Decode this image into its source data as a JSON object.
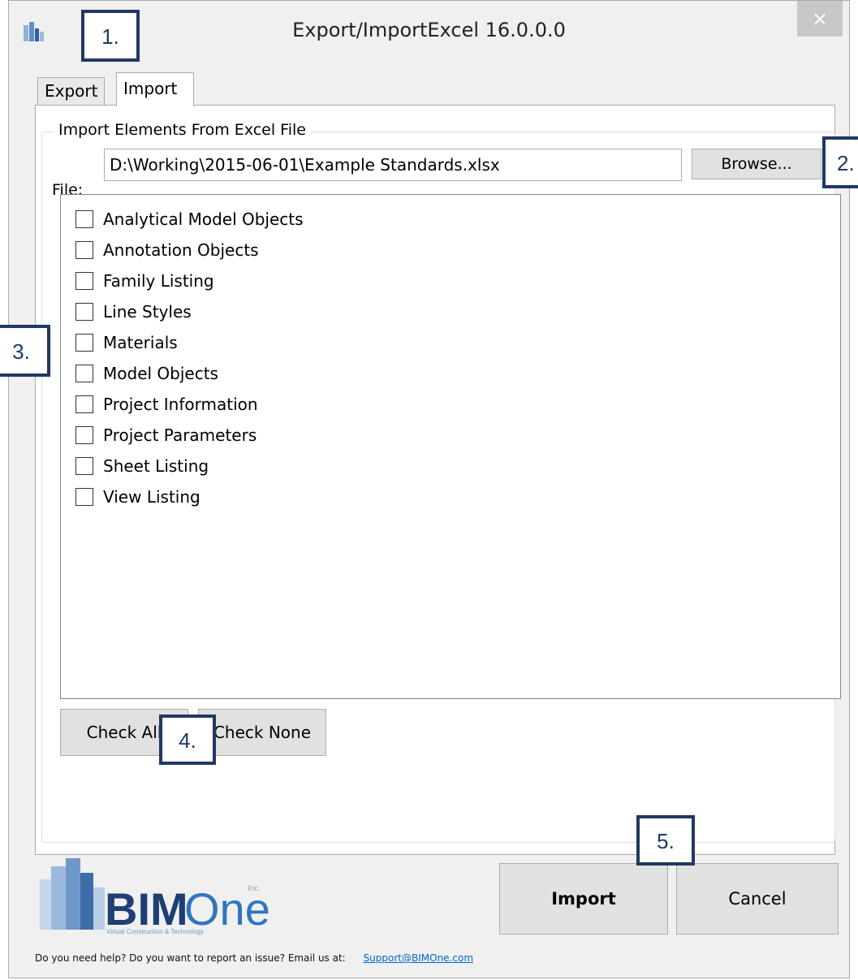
{
  "window": {
    "title": "Export/ImportExcel 16.0.0.0",
    "close_glyph": "×"
  },
  "tabs": [
    {
      "label": "Export",
      "selected": false
    },
    {
      "label": "Import",
      "selected": true
    }
  ],
  "import_group": {
    "legend": "Import Elements From Excel File",
    "file_label": "File:",
    "file_value": "D:\\Working\\2015-06-01\\Example Standards.xlsx",
    "browse_label": "Browse..."
  },
  "categories": [
    {
      "label": "Analytical Model Objects",
      "checked": false
    },
    {
      "label": "Annotation Objects",
      "checked": false
    },
    {
      "label": "Family Listing",
      "checked": false
    },
    {
      "label": "Line Styles",
      "checked": false
    },
    {
      "label": "Materials",
      "checked": false
    },
    {
      "label": "Model Objects",
      "checked": false
    },
    {
      "label": "Project Information",
      "checked": false
    },
    {
      "label": "Project Parameters",
      "checked": false
    },
    {
      "label": "Sheet Listing",
      "checked": false
    },
    {
      "label": "View Listing",
      "checked": false
    }
  ],
  "buttons": {
    "check_all": "Check All",
    "check_none": "Check None",
    "import": "Import",
    "cancel": "Cancel"
  },
  "logo": {
    "name_bold": "BIM",
    "name_light": "One",
    "suffix": "Inc.",
    "tagline": "Virtual Construction & Technology"
  },
  "footer": {
    "help_text": "Do you need help? Do you want to report an issue? Email us at:",
    "email": "Support@BIMOne.com"
  },
  "callouts": {
    "c1": "1.",
    "c2": "2.",
    "c3": "3.",
    "c4": "4.",
    "c5": "5."
  },
  "colors": {
    "callout_border": "#203864",
    "logo_blue": "#1f5fa8",
    "link": "#0066cc"
  }
}
